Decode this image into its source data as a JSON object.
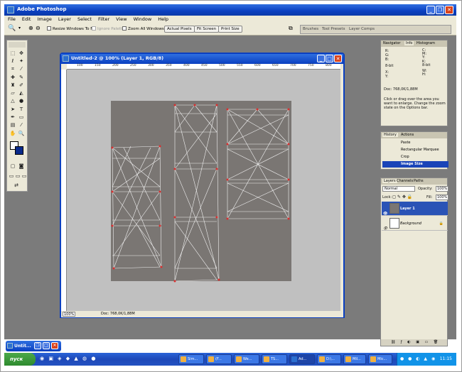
{
  "app": {
    "title": "Adobe Photoshop",
    "menu": [
      "File",
      "Edit",
      "Image",
      "Layer",
      "Select",
      "Filter",
      "View",
      "Window",
      "Help"
    ]
  },
  "options_bar": {
    "resize_windows": "Resize Windows To Fit",
    "ignore_palettes": "Ignore Palettes",
    "zoom_all": "Zoom All Windows",
    "actual_pixels": "Actual Pixels",
    "fit_screen": "Fit Screen",
    "print_size": "Print Size",
    "well_tabs": [
      "Brushes",
      "Tool Presets",
      "Layer Comps"
    ]
  },
  "document": {
    "title": "Untitled-2 @ 100% (Layer 1, RGB/8)",
    "zoom": "100%",
    "doc_info": "Doc: 768,0K/1,88M",
    "ruler_labels": [
      "100",
      "150",
      "200",
      "250",
      "300",
      "350",
      "400",
      "450",
      "500",
      "550",
      "600",
      "650",
      "700",
      "750",
      "800"
    ]
  },
  "info_panel": {
    "tabs": [
      "Navigator",
      "Info",
      "Histogram"
    ],
    "active_tab": "Info",
    "rows_left": [
      "R:",
      "G:",
      "B:",
      "8-bit",
      "X:",
      "Y:"
    ],
    "rows_right": [
      "C:",
      "M:",
      "Y:",
      "K:",
      "8-bit",
      "W:",
      "H:"
    ],
    "doc": "Doc: 768,0K/1,88M",
    "help": "Click or drag over the area you want to enlarge. Change the zoom state on the Options bar."
  },
  "history_panel": {
    "tabs": [
      "History",
      "Actions"
    ],
    "items": [
      "Paste",
      "Rectangular Marquee",
      "Crop",
      "Image Size"
    ],
    "selected": "Image Size"
  },
  "layers_panel": {
    "tabs": [
      "Layers",
      "Channels",
      "Paths"
    ],
    "blend_mode": "Normal",
    "opacity_label": "Opacity:",
    "opacity": "100%",
    "lock_label": "Lock:",
    "fill_label": "Fill:",
    "fill": "100%",
    "layers": [
      {
        "name": "Layer 1",
        "selected": true
      },
      {
        "name": "Background",
        "selected": false
      }
    ]
  },
  "mini_task": {
    "title": "Untit..."
  },
  "taskbar": {
    "start": "пуск",
    "items": [
      "Sim...",
      "(F...",
      "We...",
      "TS...",
      "Ad...",
      "D:\\...",
      "Mil...",
      "Mic..."
    ],
    "active": "Ad...",
    "clock": "11:15"
  },
  "colors": {
    "xp_blue": "#0a3fc0",
    "workspace": "#7b7b7b",
    "canvas_dark": "#7a7673",
    "selection": "#1a44b8"
  }
}
